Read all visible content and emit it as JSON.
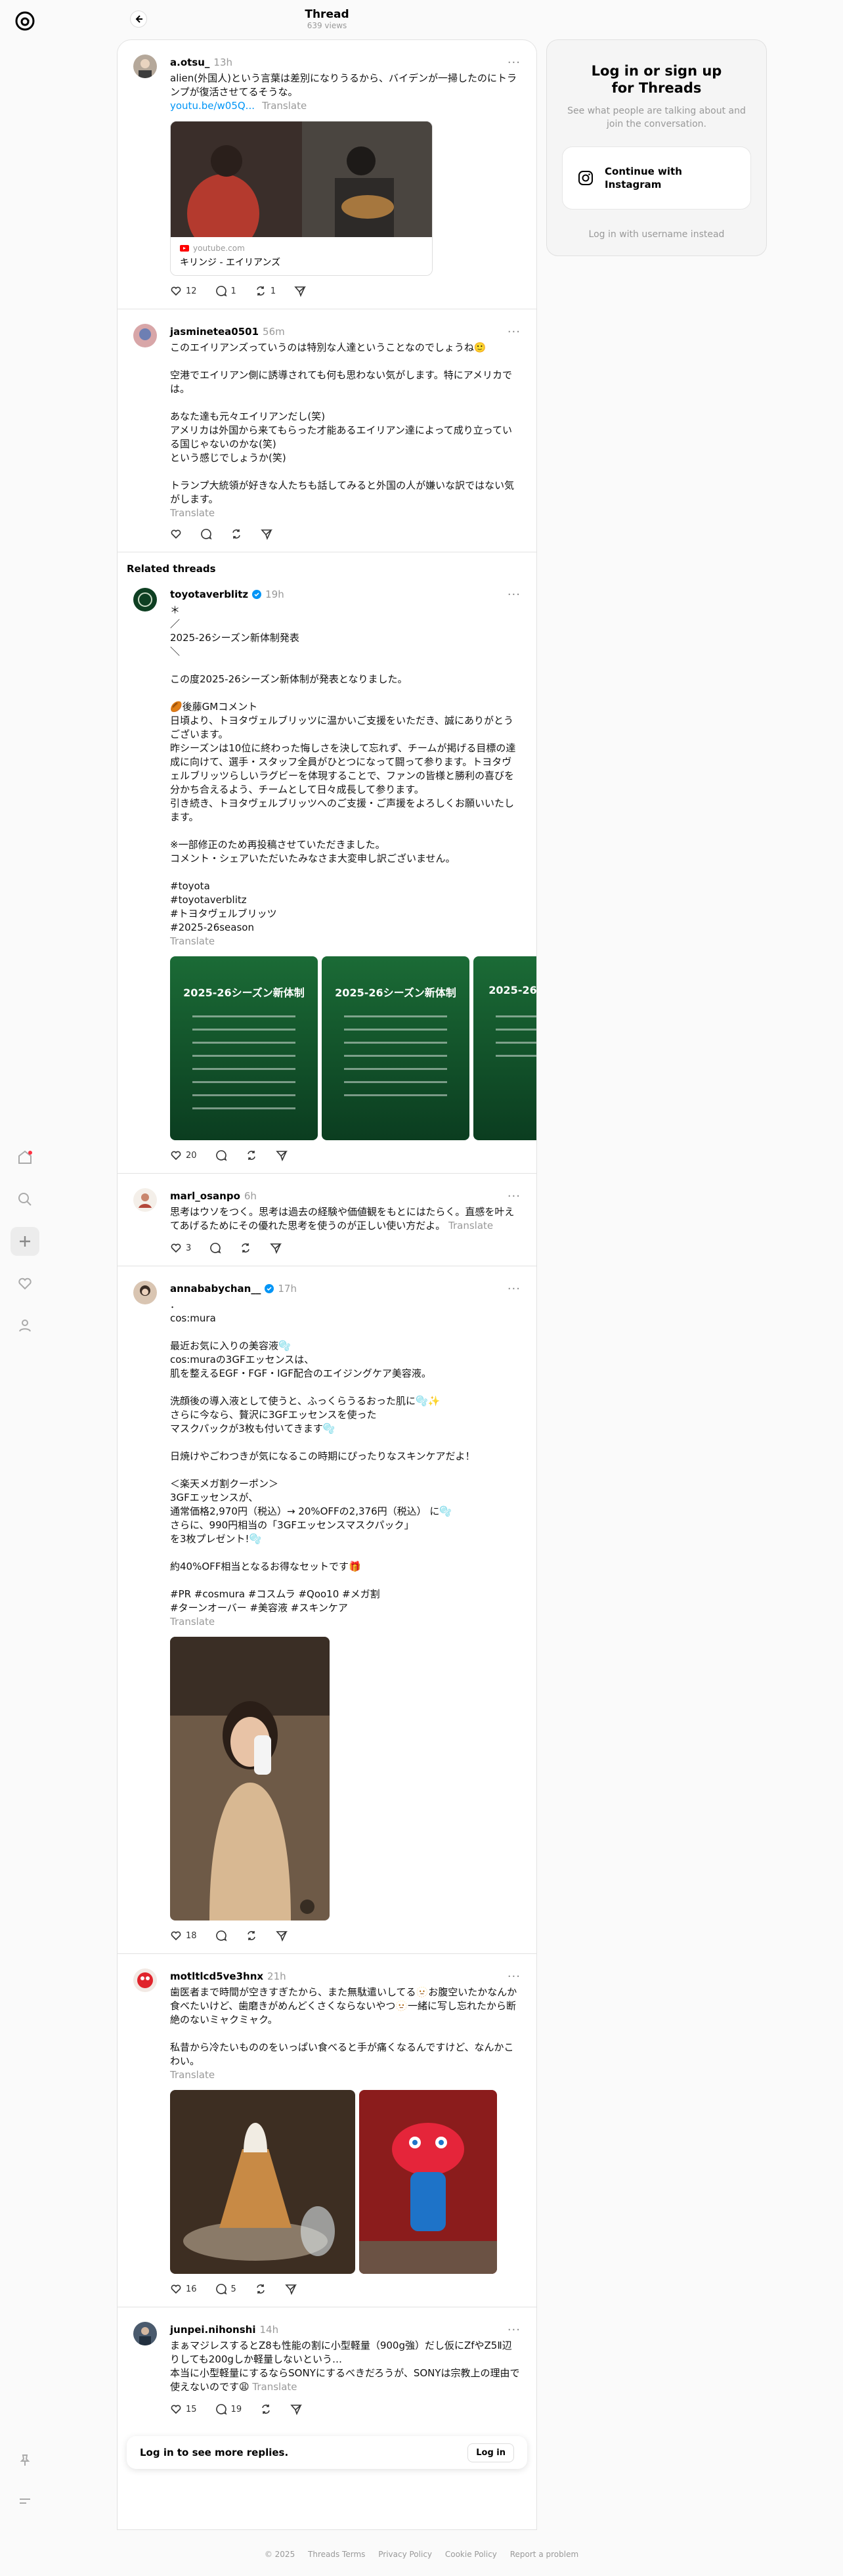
{
  "header": {
    "title": "Thread",
    "views": "639 views"
  },
  "posts_main": [
    {
      "username": "a.otsu_",
      "time": "13h",
      "text": "alien(外国人)という言葉は差別になりうるから、バイデンが一掃したのにトランプが復活させてるそうな。",
      "link": "youtu.be/w05Q...",
      "translate": "Translate",
      "link_card": {
        "domain": "youtube.com",
        "title": "キリンジ - エイリアンズ"
      },
      "likes": "12",
      "replies": "1",
      "reposts": "1"
    },
    {
      "username": "jasminetea0501",
      "time": "56m",
      "text": "このエイリアンズっていうのは特別な人達ということなのでしょうね🙂\n\n空港でエイリアン側に誘導されても何も思わない気がします。特にアメリカでは。\n\nあなた達も元々エイリアンだし(笑)\nアメリカは外国から来てもらった才能あるエイリアン達によって成り立っている国じゃないのかな(笑)\nという感じでしょうか(笑)\n\nトランプ大統領が好きな人たちも話してみると外国の人が嫌いな訳ではない気がします。",
      "translate": "Translate"
    }
  ],
  "related_title": "Related threads",
  "related": [
    {
      "username": "toyotaverblitz",
      "time": "19h",
      "text": "＊\n／\n2025-26シーズン新体制発表\n＼\n\nこの度2025-26シーズン新体制が発表となりました。\n\n🏉後藤GMコメント\n日頃より、トヨタヴェルブリッツに温かいご支援をいただき、誠にありがとうございます。\n昨シーズンは10位に終わった悔しさを決して忘れず、チームが掲げる目標の達成に向けて、選手・スタッフ全員がひとつになって闘って参ります。トヨタヴェルブリッツらしいラグビーを体現することで、ファンの皆様と勝利の喜びを分かち合えるよう、チームとして日々成長して参ります。\n引き続き、トヨタヴェルブリッツへのご支援・ご声援をよろしくお願いいたします。\n\n※一部修正のため再投稿させていただきました。\nコメント・シェアいただいたみなさま大変申し訳ございません。\n\n#toyota\n#toyotaverblitz\n#トヨタヴェルブリッツ\n#2025-26season",
      "translate": "Translate",
      "slides": [
        "2025-26シーズン新体制",
        "2025-26シーズン新体制",
        "2025-26"
      ],
      "likes": "20"
    },
    {
      "username": "marl_osanpo",
      "time": "6h",
      "text": "思考はウソをつく。思考は過去の経験や価値観をもとにはたらく。直感を叶えてあげるためにその優れた思考を使うのが正しい使い方だよ。",
      "translate": "Translate",
      "likes": "3"
    },
    {
      "username": "annababychan__",
      "time": "17h",
      "text": "．\ncos:mura\n\n最近お気に入りの美容液🫧\ncos:muraの3GFエッセンスは、\n肌を整えるEGF・FGF・IGF配合のエイジングケア美容液。\n\n洗顔後の導入液として使うと、ふっくらうるおった肌に🫧✨\nさらに今なら、贅沢に3GFエッセンスを使った\nマスクパックが3枚も付いてきます🫧\n\n日焼けやごわつきが気になるこの時期にぴったりなスキンケアだよ！\n\n＜楽天メガ割クーポン＞\n3GFエッセンスが、\n通常価格2,970円（税込）→ 20%OFFの2,376円（税込） に🫧\nさらに、990円相当の「3GFエッセンスマスクパック」\nを3枚プレゼント!🫧\n\n約40%OFF相当となるお得なセットです🎁\n\n#PR #cosmura #コスムラ #Qoo10 #メガ割\n#ターンオーバー #美容液 #スキンケア",
      "translate": "Translate",
      "likes": "18"
    },
    {
      "username": "motltlcd5ve3hnx",
      "time": "21h",
      "text": "歯医者まで時間が空きすぎたから、また無駄遣いしてる🫥お腹空いたかなんか食べたいけど、歯磨きがめんどくさくならないやつ🫥一緒に写し忘れたから断絶のないミャクミャク。\n\n私昔から冷たいもののをいっぱい食べると手が痛くなるんですけど、なんかこわい。",
      "translate": "Translate",
      "likes": "16",
      "replies": "5"
    },
    {
      "username": "junpei.nihonshi",
      "time": "14h",
      "text": "まぁマジレスするとZ8も性能の割に小型軽量（900g強）だし仮にZfやZ5Ⅱ辺りしても200gしか軽量しないという…\n本当に小型軽量にするならSONYにするべきだろうが、SONYは宗教上の理由で使えないのです😩",
      "translate": "Translate",
      "likes": "15",
      "replies": "19"
    }
  ],
  "login_more": {
    "text": "Log in to see more replies.",
    "button": "Log in"
  },
  "right_panel": {
    "title": "Log in or sign up\nfor Threads",
    "subtitle": "See what people are talking about and join the conversation.",
    "button": "Continue with Instagram",
    "alt": "Log in with username instead"
  },
  "footer": [
    "© 2025",
    "Threads Terms",
    "Privacy Policy",
    "Cookie Policy",
    "Report a problem"
  ],
  "colors": {
    "link": "#0095f6",
    "verified": "#0095f6",
    "border": "#e2e2e2",
    "muted": "#999999"
  }
}
